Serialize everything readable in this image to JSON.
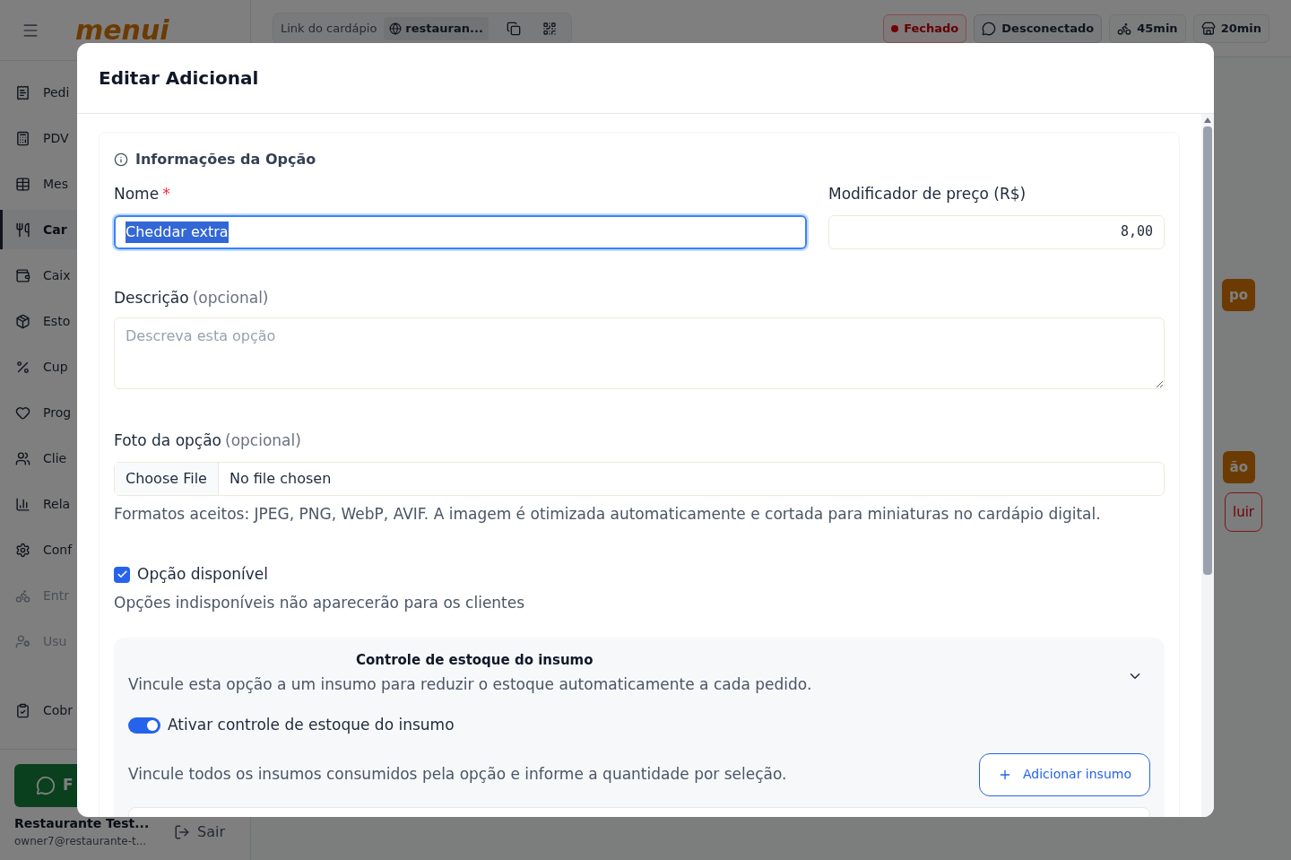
{
  "sidebar": {
    "logo": "menui",
    "items": [
      {
        "label": "Pedi",
        "selected": false,
        "disabled": false
      },
      {
        "label": "PDV",
        "selected": false,
        "disabled": false
      },
      {
        "label": "Mes",
        "selected": false,
        "disabled": false
      },
      {
        "label": "Car",
        "selected": true,
        "disabled": false
      },
      {
        "label": "Caix",
        "selected": false,
        "disabled": false
      },
      {
        "label": "Esto",
        "selected": false,
        "disabled": false
      },
      {
        "label": "Cup",
        "selected": false,
        "disabled": false
      },
      {
        "label": "Prog",
        "selected": false,
        "disabled": false
      },
      {
        "label": "Clie",
        "selected": false,
        "disabled": false
      },
      {
        "label": "Rela",
        "selected": false,
        "disabled": false
      },
      {
        "label": "Conf",
        "selected": false,
        "disabled": false
      },
      {
        "label": "Entr",
        "selected": false,
        "disabled": true
      },
      {
        "label": "Usu",
        "selected": false,
        "disabled": true
      },
      {
        "label": "Cobr",
        "selected": false,
        "disabled": false
      }
    ],
    "whatsapp_button": "F",
    "user": {
      "name": "Restaurante Test...",
      "email": "owner7@restaurante-t..."
    },
    "logout": "Sair"
  },
  "topbar": {
    "link_label": "Link do cardápio",
    "link_value": "restauran...",
    "status": [
      {
        "label": "Fechado",
        "kind": "closed"
      },
      {
        "label": "Desconectado",
        "kind": "whatsapp"
      },
      {
        "label": "45min",
        "kind": "delivery"
      },
      {
        "label": "20min",
        "kind": "pickup"
      }
    ]
  },
  "background_buttons": [
    {
      "label": "po",
      "kind": "filled"
    },
    {
      "label": "ão",
      "kind": "filled"
    },
    {
      "label": "luir",
      "kind": "outline"
    }
  ],
  "modal": {
    "title": "Editar Adicional",
    "section_title": "Informações da Opção",
    "name": {
      "label": "Nome",
      "required": "*",
      "value": "Cheddar extra",
      "text_selected": true
    },
    "price": {
      "label": "Modificador de preço (R$)",
      "value": "8,00"
    },
    "description": {
      "label": "Descrição",
      "optional": "(opcional)",
      "placeholder": "Descreva esta opção"
    },
    "photo": {
      "label": "Foto da opção",
      "optional": "(opcional)",
      "button": "Choose File",
      "status": "No file chosen",
      "help": "Formatos aceitos: JPEG, PNG, WebP, AVIF. A imagem é otimizada automaticamente e cortada para miniaturas no cardápio digital."
    },
    "available": {
      "label": "Opção disponível",
      "checked": true,
      "help": "Opções indisponíveis não aparecerão para os clientes"
    },
    "stock": {
      "title": "Controle de estoque do insumo",
      "description": "Vincule esta opção a um insumo para reduzir o estoque automaticamente a cada pedido.",
      "expanded": true,
      "toggle_label": "Ativar controle de estoque do insumo",
      "toggle_on": true,
      "hint": "Vincule todos os insumos consumidos pela opção e informe a quantidade por seleção.",
      "add_button": "Adicionar insumo"
    }
  }
}
